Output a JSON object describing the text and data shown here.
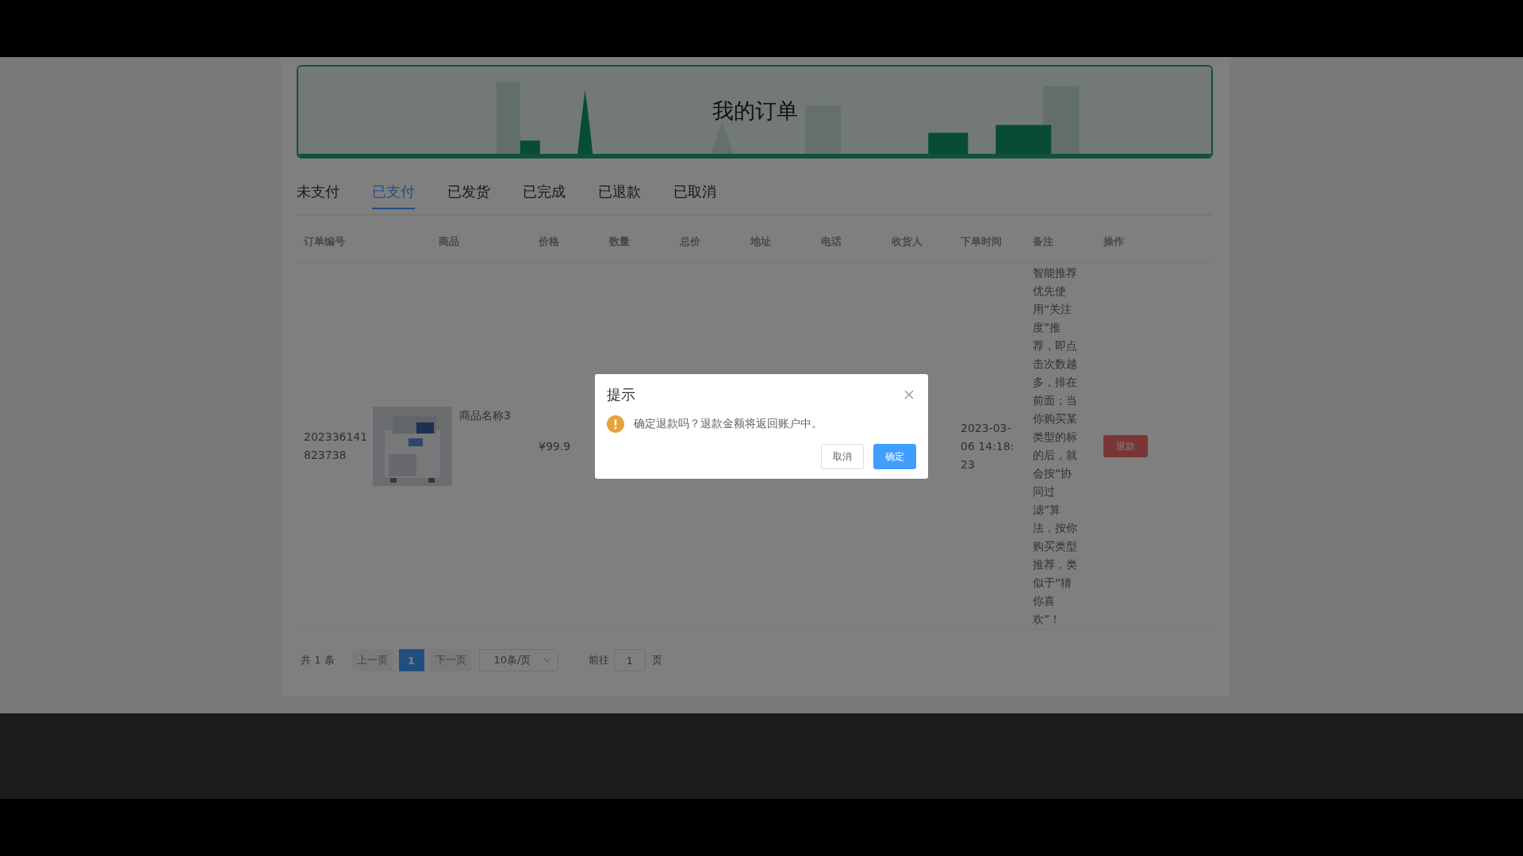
{
  "page_title": "我的订单",
  "tabs": [
    {
      "label": "未支付",
      "selected": false
    },
    {
      "label": "已支付",
      "selected": true
    },
    {
      "label": "已发货",
      "selected": false
    },
    {
      "label": "已完成",
      "selected": false
    },
    {
      "label": "已退款",
      "selected": false
    },
    {
      "label": "已取消",
      "selected": false
    }
  ],
  "table": {
    "columns": [
      "订单编号",
      "商品",
      "价格",
      "数量",
      "总价",
      "地址",
      "电话",
      "收货人",
      "下单时间",
      "备注",
      "操作"
    ],
    "rows": [
      {
        "order_no": "202336141823738",
        "product_name": "商品名称3",
        "price": "¥99.9",
        "order_time": "2023-03-06 14:18:23",
        "note": "智能推荐优先使用“关注度”推荐，即点击次数越多，排在前面；当你购买某类型的标的后，就会按“协同过滤”算法，按你购买类型推荐，类似于“猜你喜欢”！",
        "action": "退款"
      }
    ]
  },
  "pagination": {
    "total": "共 1 条",
    "prev": {
      "label": "上一页",
      "disabled": true
    },
    "pages": [
      {
        "label": "1",
        "selected": true
      }
    ],
    "next": {
      "label": "下一页",
      "disabled": true
    },
    "page_size": "10条/页",
    "goto_label": "前往",
    "goto_value": "1",
    "goto_unit": "页"
  },
  "dialog": {
    "title": "提示",
    "message": "确定退款吗？退款金额将返回账户中。",
    "buttons": [
      {
        "label": "取消",
        "kind": "default"
      },
      {
        "label": "确定",
        "kind": "primary"
      }
    ]
  }
}
